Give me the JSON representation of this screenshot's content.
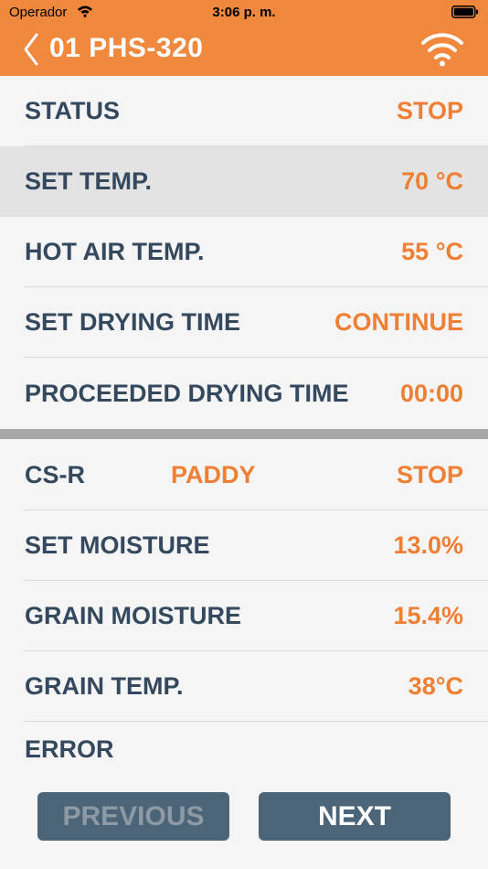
{
  "status_bar": {
    "carrier": "Operador",
    "time": "3:06 p. m."
  },
  "header": {
    "title": "01  PHS-320"
  },
  "dryer": {
    "rows": [
      {
        "label": "STATUS",
        "value": "STOP"
      },
      {
        "label": "SET TEMP.",
        "value": "70 °C"
      },
      {
        "label": "HOT AIR TEMP.",
        "value": "55 °C"
      },
      {
        "label": "SET DRYING TIME",
        "value": "CONTINUE"
      },
      {
        "label": "PROCEEDED DRYING TIME",
        "value": "00:00"
      }
    ]
  },
  "meter": {
    "name": "CS-R",
    "grain": "PADDY",
    "status": "STOP",
    "rows": [
      {
        "label": "SET MOISTURE",
        "value": "13.0%"
      },
      {
        "label": "GRAIN MOISTURE",
        "value": "15.4%"
      },
      {
        "label": "GRAIN TEMP.",
        "value": "38°C"
      }
    ],
    "error_label": "ERROR"
  },
  "buttons": {
    "previous": "PREVIOUS",
    "next": "NEXT"
  },
  "colors": {
    "accent": "#f0883e",
    "value": "#ee7f34",
    "label": "#34495e",
    "button": "#4b6477"
  }
}
